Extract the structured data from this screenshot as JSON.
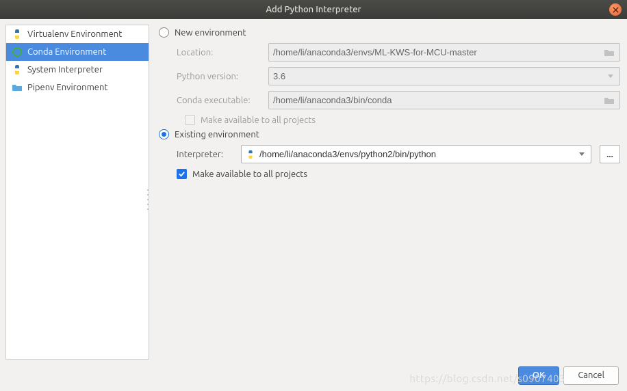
{
  "titlebar": {
    "title": "Add Python Interpreter"
  },
  "sidebar": {
    "items": [
      {
        "label": "Virtualenv Environment"
      },
      {
        "label": "Conda Environment"
      },
      {
        "label": "System Interpreter"
      },
      {
        "label": "Pipenv Environment"
      }
    ]
  },
  "main": {
    "new_env_label": "New environment",
    "existing_env_label": "Existing environment",
    "new_env": {
      "location_label": "Location:",
      "location_value": "/home/li/anaconda3/envs/ML-KWS-for-MCU-master",
      "python_version_label": "Python version:",
      "python_version_value": "3.6",
      "conda_exec_label": "Conda executable:",
      "conda_exec_value": "/home/li/anaconda3/bin/conda",
      "available_all_label": "Make available to all projects"
    },
    "existing_env": {
      "interpreter_label": "Interpreter:",
      "interpreter_value": "/home/li/anaconda3/envs/python2/bin/python",
      "available_all_label": "Make available to all projects",
      "browse_label": "..."
    }
  },
  "footer": {
    "ok": "OK",
    "cancel": "Cancel"
  },
  "watermark": "https://blog.csdn.net/s0907403"
}
